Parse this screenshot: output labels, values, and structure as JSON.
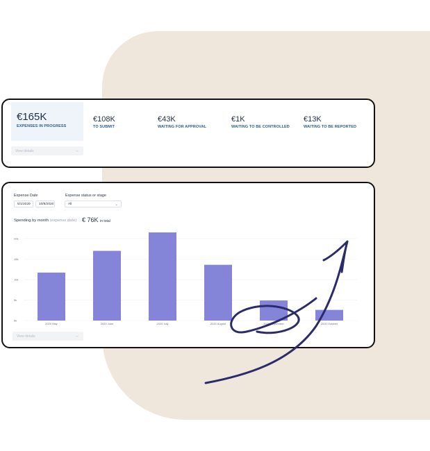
{
  "summary": {
    "active": {
      "amount": "€165K",
      "label": "EXPENSES IN PROGRESS"
    },
    "items": [
      {
        "amount": "€108K",
        "label": "TO SUBMIT"
      },
      {
        "amount": "€43K",
        "label": "WAITING FOR APPROVAL"
      },
      {
        "amount": "€1K",
        "label": "WAITING TO BE CONTROLLED"
      },
      {
        "amount": "€13K",
        "label": "WAITING TO BE REPORTED"
      }
    ],
    "view_details": "View details",
    "arrow_icon": "arrow-right-icon"
  },
  "filters": {
    "expense_date_label": "Expense Date",
    "date_from": "5/1/2020",
    "date_to": "10/8/2020",
    "status_label": "Expense status or stage",
    "status_value": "All"
  },
  "chart": {
    "title": "Spending by month",
    "title_sub": "(expense date)",
    "total": "€ 76K",
    "total_sub": "in total",
    "view_details": "View details",
    "bar_color": "#8485d9"
  },
  "chart_data": {
    "type": "bar",
    "categories": [
      "2020 May",
      "2020 June",
      "2020 July",
      "2020 August",
      "2020 September",
      "2020 October"
    ],
    "values": [
      11.7,
      17,
      21.5,
      13.6,
      4.9,
      2.6
    ],
    "ylim": [
      0,
      22
    ],
    "ytick_labels": [
      "0k",
      "5k",
      "10k",
      "15k",
      "20k"
    ],
    "ytick_values": [
      0,
      5,
      10,
      15,
      20
    ],
    "grid": true,
    "xlabel": "",
    "ylabel": ""
  }
}
